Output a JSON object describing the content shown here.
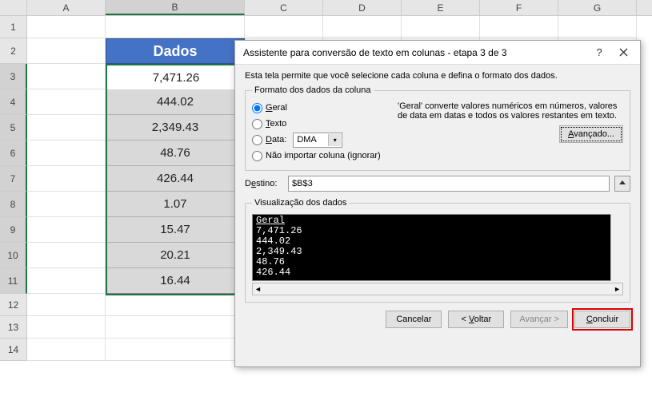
{
  "columns": [
    "A",
    "B",
    "C",
    "D",
    "E",
    "F",
    "G"
  ],
  "rows": [
    "1",
    "2",
    "3",
    "4",
    "5",
    "6",
    "7",
    "8",
    "9",
    "10",
    "11",
    "12",
    "13",
    "14"
  ],
  "table": {
    "header": "Dados",
    "values": [
      "7,471.26",
      "444.02",
      "2,349.43",
      "48.76",
      "426.44",
      "1.07",
      "15.47",
      "20.21",
      "16.44"
    ]
  },
  "dialog": {
    "title": "Assistente para conversão de texto em colunas - etapa 3 de 3",
    "help_symbol": "?",
    "intro": "Esta tela permite que você selecione cada coluna e defina o formato dos dados.",
    "format_legend": "Formato dos dados da coluna",
    "radios": {
      "geral": "Geral",
      "texto": "Texto",
      "data": "Data:",
      "dma": "DMA",
      "ignore": "Não importar coluna (ignorar)"
    },
    "geral_desc": "'Geral' converte valores numéricos em números, valores de data em datas e todos os valores restantes em texto.",
    "advanced": "Avançado...",
    "dest_label": "Destino:",
    "dest_value": "$B$3",
    "preview_legend": "Visualização dos dados",
    "preview_header": "Geral",
    "preview_lines": [
      "7,471.26",
      "444.02",
      "2,349.43",
      "48.76",
      "426.44"
    ],
    "buttons": {
      "cancel": "Cancelar",
      "back": "< Voltar",
      "next": "Avançar >",
      "finish": "Concluir"
    }
  },
  "chart_data": {
    "type": "table",
    "title": "Dados",
    "categories": [
      "Dados"
    ],
    "values": [
      7471.26,
      444.02,
      2349.43,
      48.76,
      426.44,
      1.07,
      15.47,
      20.21,
      16.44
    ]
  }
}
